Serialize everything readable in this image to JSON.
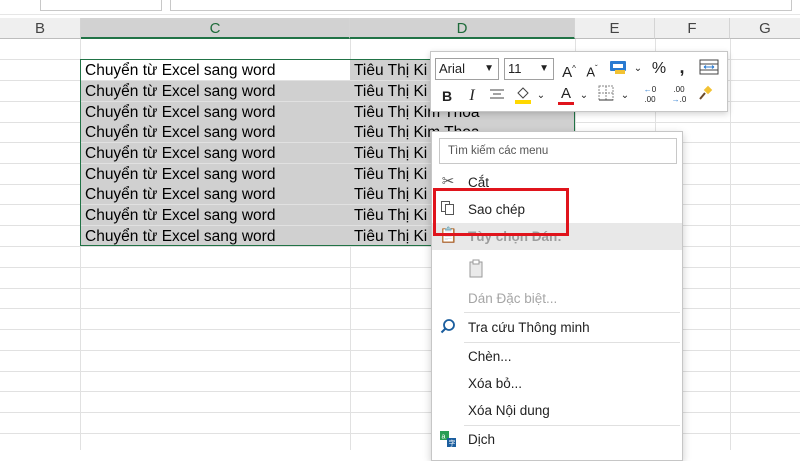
{
  "columns": [
    {
      "label": "B",
      "selected": false
    },
    {
      "label": "C",
      "selected": true
    },
    {
      "label": "D",
      "selected": true
    },
    {
      "label": "E",
      "selected": false
    },
    {
      "label": "F",
      "selected": false
    },
    {
      "label": "G",
      "selected": false
    }
  ],
  "rows": [
    {
      "c": "Chuyển từ Excel sang word",
      "d": "Tiêu Thị Ki"
    },
    {
      "c": "Chuyển từ Excel sang word",
      "d": "Tiêu Thị Ki"
    },
    {
      "c": "Chuyển từ Excel sang word",
      "d": "Tiêu Thị Kim Thoa"
    },
    {
      "c": "Chuyển từ Excel sang word",
      "d": "Tiêu Thị Kim Thoa"
    },
    {
      "c": "Chuyển từ Excel sang word",
      "d": "Tiêu Thị Ki"
    },
    {
      "c": "Chuyển từ Excel sang word",
      "d": "Tiêu Thị Ki"
    },
    {
      "c": "Chuyển từ Excel sang word",
      "d": "Tiêu Thị Ki"
    },
    {
      "c": "Chuyển từ Excel sang word",
      "d": "Tiêu Thị Ki"
    },
    {
      "c": "Chuyển từ Excel sang word",
      "d": "Tiêu Thị Ki"
    }
  ],
  "mini_toolbar": {
    "font_name": "Arial",
    "font_size": "11",
    "grow_font": "A",
    "shrink_font": "A",
    "percent": "%",
    "comma": ",",
    "bold": "B",
    "italic": "I",
    "font_color": "A",
    "increase_decimal": ".00",
    "decrease_decimal": ".0"
  },
  "context_menu": {
    "search_placeholder": "Tìm kiếm các menu",
    "cut": "Cắt",
    "copy": "Sao chép",
    "paste_options": "Tùy chọn Dán:",
    "paste_special": "Dán Đặc biệt...",
    "smart_lookup": "Tra cứu Thông minh",
    "insert": "Chèn...",
    "delete": "Xóa bỏ...",
    "clear_contents": "Xóa Nội dung",
    "translate": "Dịch"
  },
  "colors": {
    "selection_border": "#217346",
    "highlight_box": "#e0141c",
    "fill_highlight": "#ffd800",
    "font_color_bar": "#e0141c"
  }
}
